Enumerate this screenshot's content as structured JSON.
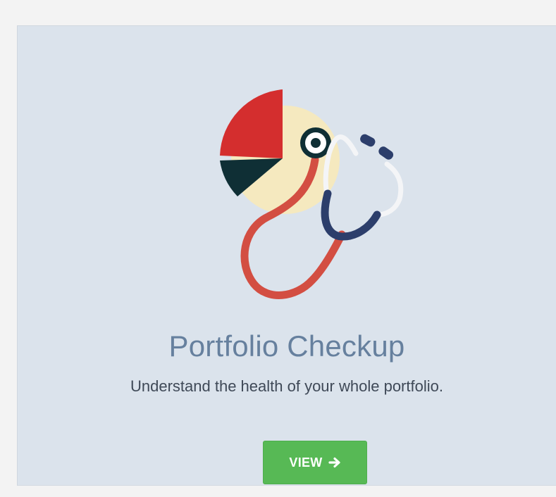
{
  "card": {
    "title": "Portfolio Checkup",
    "description": "Understand the health of your whole portfolio.",
    "button_label": "VIEW",
    "button_icon": "arrow-right-icon",
    "illustration_icon": "portfolio-checkup-illustration"
  },
  "colors": {
    "page_background": "#f3f3f3",
    "card_background": "#dbe3ec",
    "title": "#66809e",
    "description": "#3f4957",
    "button": "#57b955",
    "button_text": "#ffffff",
    "pie_red": "#d42e2e",
    "pie_dark": "#0f2f35",
    "pie_cream": "#f5e9bf",
    "stethoscope_tube": "#d34e42",
    "stethoscope_navy": "#2c3e6b",
    "stethoscope_white": "#f4f5f7"
  }
}
